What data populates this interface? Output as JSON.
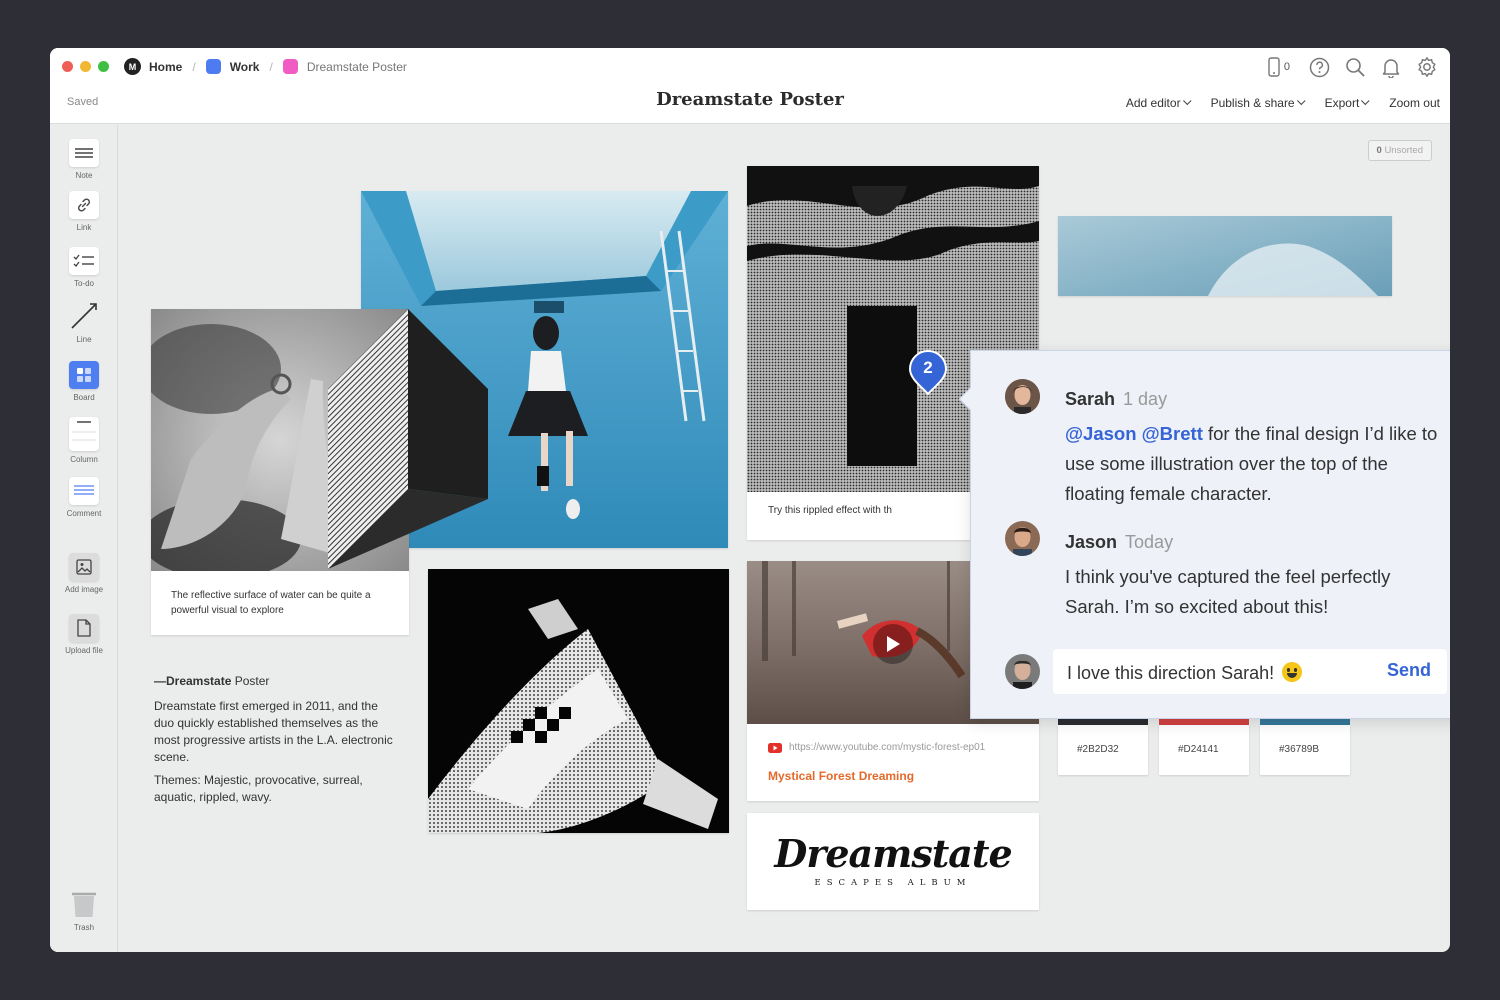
{
  "window": {
    "breadcrumbs": [
      {
        "label": "Home"
      },
      {
        "label": "Work",
        "color": "#4e7cf0"
      },
      {
        "label": "Dreamstate Poster",
        "color": "#f05cc4"
      }
    ],
    "status": "Saved",
    "title": "Dreamstate Poster",
    "device_count": "0",
    "menu": {
      "add_editor": "Add editor",
      "publish": "Publish & share",
      "export": "Export",
      "zoom": "Zoom out"
    }
  },
  "sidebar": {
    "tools": [
      {
        "label": "Note",
        "icon": "note-icon"
      },
      {
        "label": "Link",
        "icon": "link-icon"
      },
      {
        "label": "To-do",
        "icon": "todo-icon"
      },
      {
        "label": "Line",
        "icon": "line-icon"
      },
      {
        "label": "Board",
        "icon": "board-icon"
      },
      {
        "label": "Column",
        "icon": "column-icon"
      },
      {
        "label": "Comment",
        "icon": "comment-icon"
      },
      {
        "label": "Add image",
        "icon": "image-icon"
      },
      {
        "label": "Upload file",
        "icon": "file-icon"
      }
    ],
    "trash": "Trash"
  },
  "canvas": {
    "unsorted_count": "0",
    "unsorted_label": "Unsorted",
    "water_caption": "The reflective surface of water can be quite a powerful visual to explore",
    "rippled_caption": "Try this rippled effect with th",
    "description": {
      "title_bold": "—Dreamstate",
      "title_rest": " Poster",
      "body": "Dreamstate first emerged in 2011, and the duo quickly established themselves as the most progressive artists in the L.A. electronic scene.",
      "themes": "Themes: Majestic, provocative, surreal, aquatic, rippled, wavy."
    },
    "video": {
      "url": "https://www.youtube.com/mystic-forest-ep01",
      "title": "Mystical Forest Dreaming"
    },
    "logo": {
      "name": "Dreamstate",
      "subtitle": "ESCAPES ALBUM"
    },
    "swatches": [
      {
        "hex": "#2B2D32",
        "color": "#2b2d32"
      },
      {
        "hex": "#D24141",
        "color": "#d24141"
      },
      {
        "hex": "#36789B",
        "color": "#36789b"
      }
    ],
    "pin_count": "2"
  },
  "comments": {
    "thread": [
      {
        "author": "Sarah",
        "time": "1 day",
        "mentions": "@Jason @Brett",
        "text": " for the final design I’d like to use some illustration over the top of the floating female character."
      },
      {
        "author": "Jason",
        "time": "Today",
        "text": "I think you've captured the feel perfectly Sarah. I’m so excited about this!"
      }
    ],
    "reply_text": "I love this direction Sarah!",
    "send_label": "Send"
  }
}
